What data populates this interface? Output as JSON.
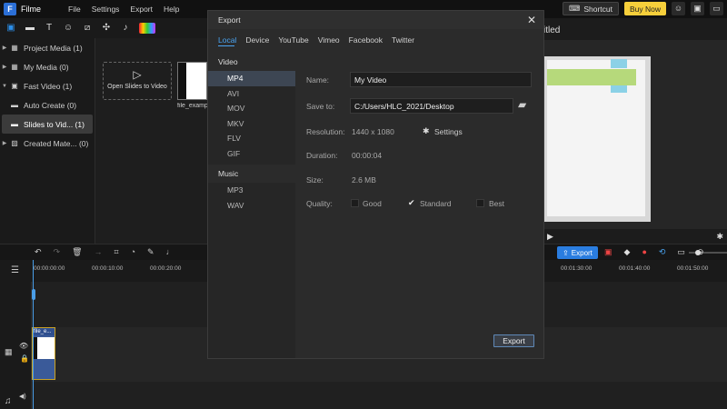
{
  "app": {
    "name": "Filme",
    "menu": [
      "File",
      "Settings",
      "Export",
      "Help"
    ],
    "shortcut_label": "Shortcut",
    "buy_label": "Buy Now"
  },
  "sidebar": {
    "items": [
      {
        "label": "Project Media (1)",
        "selected": false
      },
      {
        "label": "My Media (0)",
        "selected": false
      },
      {
        "label": "Fast Video (1)",
        "selected": false
      },
      {
        "label": "Auto Create (0)",
        "selected": false
      },
      {
        "label": "Slides to Vid... (1)",
        "selected": true
      },
      {
        "label": "Created Mate... (0)",
        "selected": false
      }
    ]
  },
  "media": {
    "open_slides_label": "Open Slides to Video",
    "thumb_label": "file_examp"
  },
  "preview": {
    "title": "itled"
  },
  "timeline": {
    "export_label": "Export",
    "ruler_ticks": [
      "00:00:00:00",
      "00:00:10:00",
      "00:00:20:00",
      "00:01:30:00",
      "00:01:40:00",
      "00:01:50:00"
    ],
    "clip_label": "file_e..."
  },
  "dialog": {
    "title": "Export",
    "tabs": [
      "Local",
      "Device",
      "YouTube",
      "Vimeo",
      "Facebook",
      "Twitter"
    ],
    "active_tab": "Local",
    "video_header": "Video",
    "video_formats": [
      "MP4",
      "AVI",
      "MOV",
      "MKV",
      "FLV",
      "GIF"
    ],
    "selected_format": "MP4",
    "music_header": "Music",
    "music_formats": [
      "MP3",
      "WAV"
    ],
    "name_label": "Name:",
    "name_value": "My Video",
    "save_label": "Save to:",
    "save_value": "C:/Users/HLC_2021/Desktop",
    "resolution_label": "Resolution:",
    "resolution_value": "1440 x 1080",
    "settings_label": "Settings",
    "duration_label": "Duration:",
    "duration_value": "00:00:04",
    "size_label": "Size:",
    "size_value": "2.6 MB",
    "quality_label": "Quality:",
    "quality_options": [
      "Good",
      "Standard",
      "Best"
    ],
    "quality_selected": "Standard",
    "export_button": "Export"
  }
}
